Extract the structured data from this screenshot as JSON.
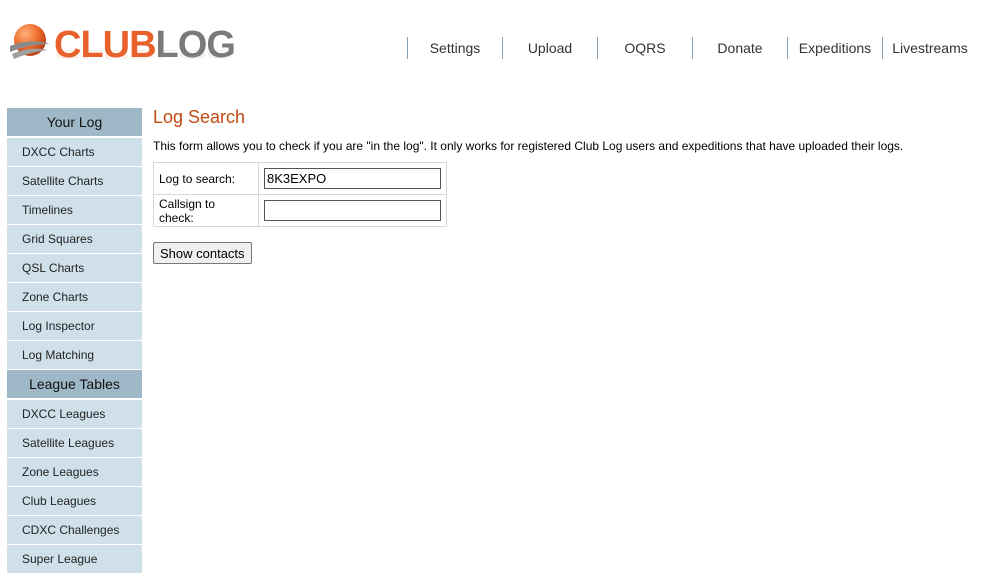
{
  "logo": {
    "club": "CLUB",
    "log": "LOG"
  },
  "topnav": [
    "Settings",
    "Upload",
    "OQRS",
    "Donate",
    "Expeditions",
    "Livestreams"
  ],
  "sidebar": {
    "sections": [
      {
        "title": "Your Log",
        "items": [
          "DXCC Charts",
          "Satellite Charts",
          "Timelines",
          "Grid Squares",
          "QSL Charts",
          "Zone Charts",
          "Log Inspector",
          "Log Matching"
        ]
      },
      {
        "title": "League Tables",
        "items": [
          "DXCC Leagues",
          "Satellite Leagues",
          "Zone Leagues",
          "Club Leagues",
          "CDXC Challenges",
          "Super League"
        ]
      }
    ]
  },
  "main": {
    "title": "Log Search",
    "intro": "This form allows you to check if you are \"in the log\". It only works for registered Club Log users and expeditions that have uploaded their logs.",
    "log_label": "Log to search:",
    "log_value": "8K3EXPO",
    "call_label": "Callsign to check:",
    "call_value": "",
    "button": "Show contacts"
  },
  "colors": {
    "accent": "#c04a12",
    "logo_orange": "#e8602c",
    "sidebar_header": "#9fb8c7",
    "sidebar_item": "#cfe0ea"
  }
}
